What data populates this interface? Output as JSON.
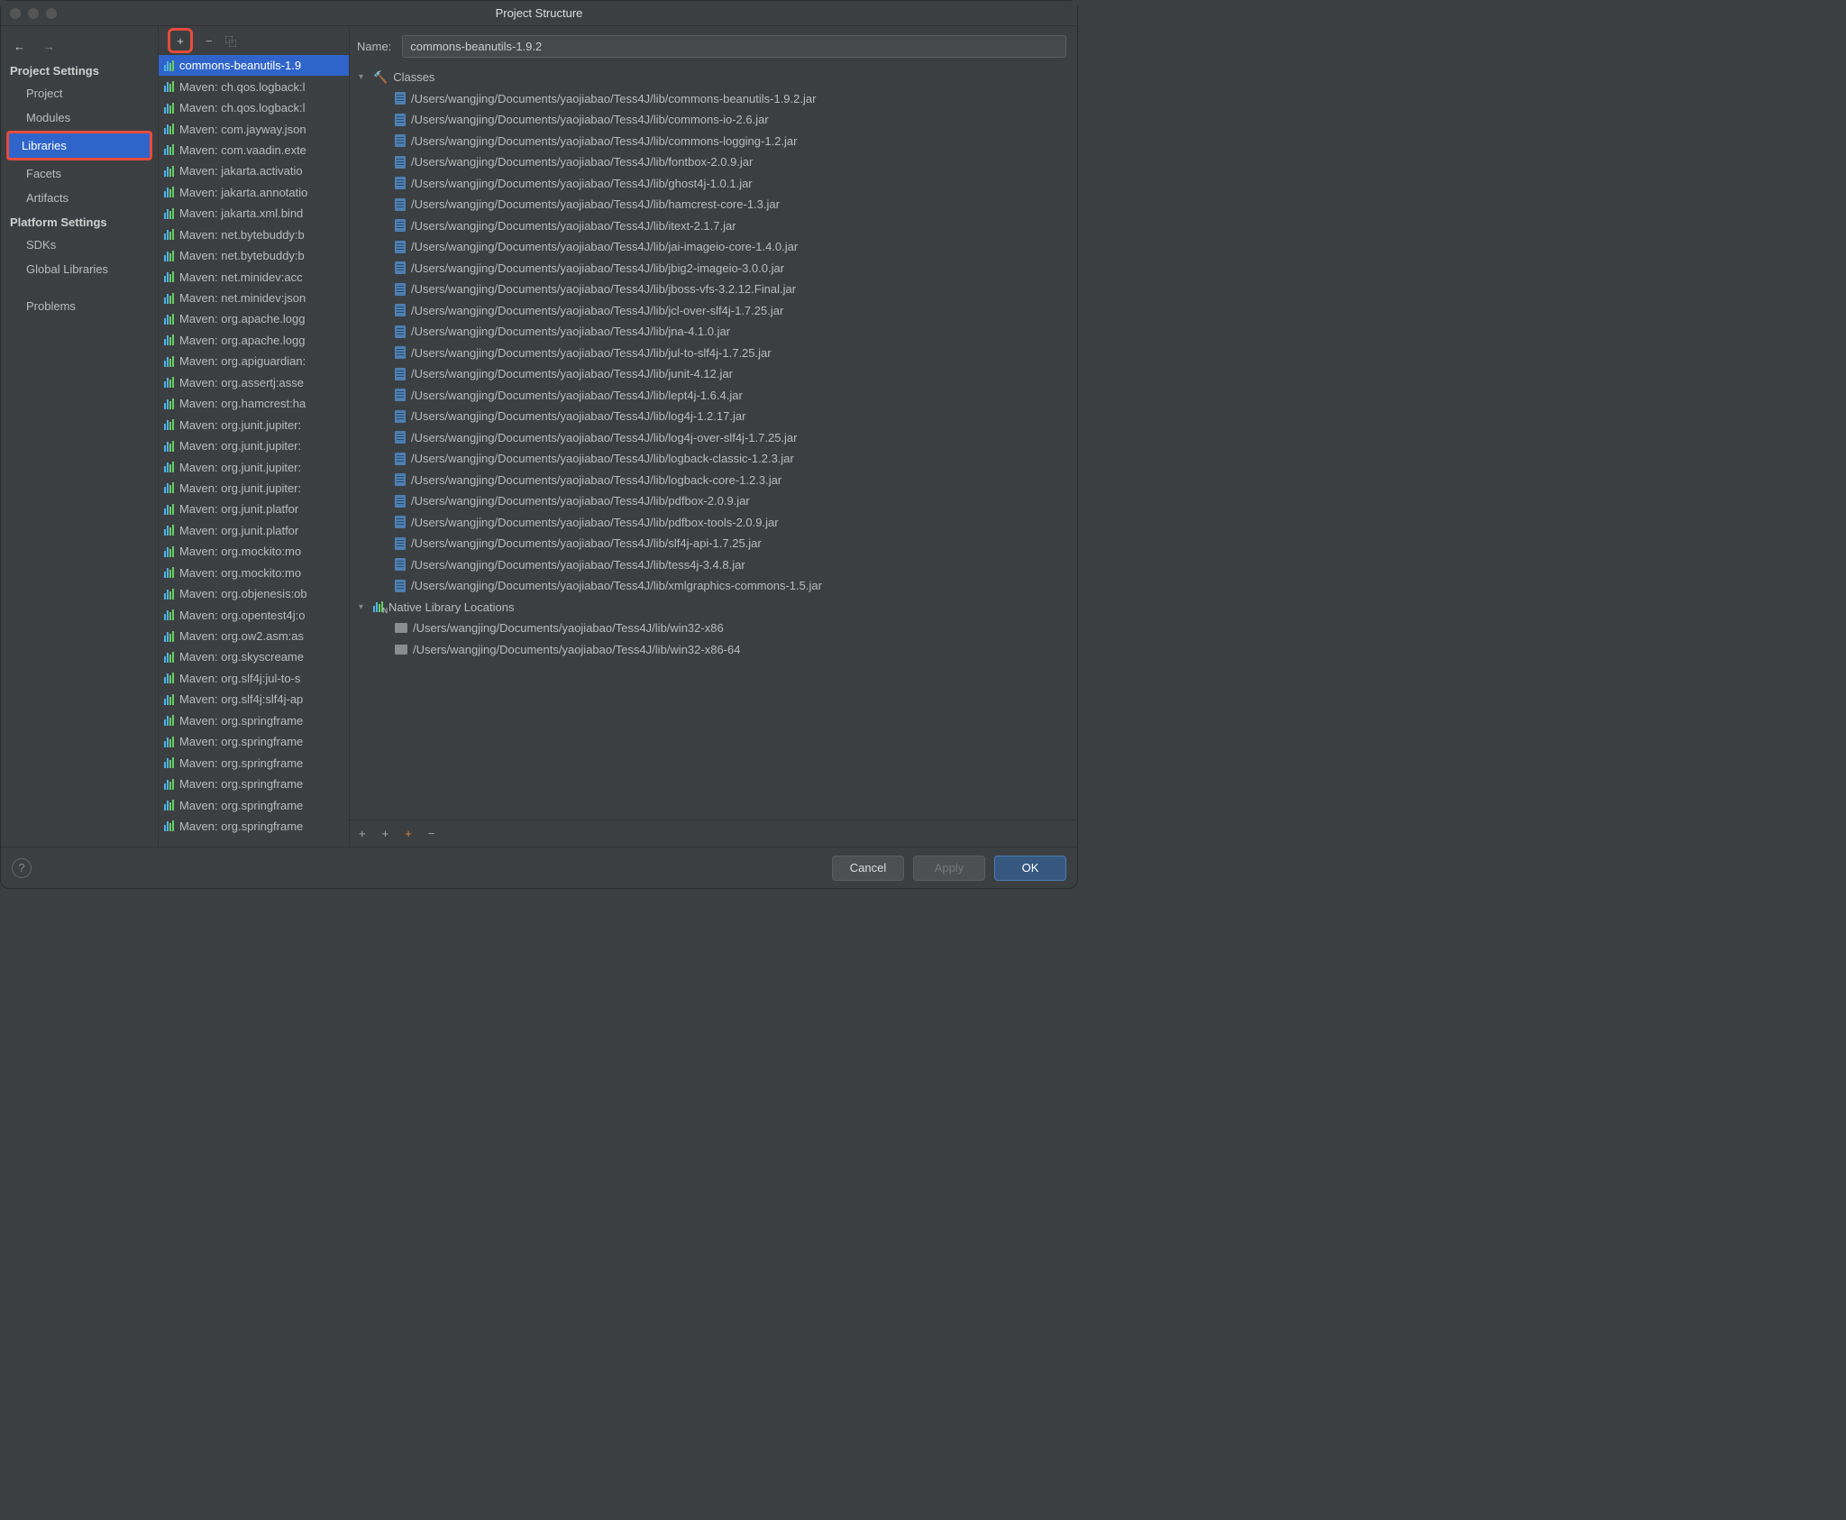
{
  "window": {
    "title": "Project Structure"
  },
  "leftnav": {
    "arrows": {
      "back": "←",
      "fwd": "→"
    },
    "groups": [
      {
        "heading": "Project Settings",
        "items": [
          {
            "key": "project",
            "label": "Project"
          },
          {
            "key": "modules",
            "label": "Modules"
          },
          {
            "key": "libraries",
            "label": "Libraries",
            "selected": true
          },
          {
            "key": "facets",
            "label": "Facets"
          },
          {
            "key": "artifacts",
            "label": "Artifacts"
          }
        ]
      },
      {
        "heading": "Platform Settings",
        "items": [
          {
            "key": "sdks",
            "label": "SDKs"
          },
          {
            "key": "global-libs",
            "label": "Global Libraries"
          }
        ]
      },
      {
        "heading": "",
        "items": [
          {
            "key": "problems",
            "label": "Problems"
          }
        ]
      }
    ]
  },
  "midtoolbar": {
    "add": "+",
    "remove": "−",
    "copy": "⿻"
  },
  "libraries": [
    {
      "label": "commons-beanutils-1.9",
      "selected": true
    },
    {
      "label": "Maven: ch.qos.logback:l"
    },
    {
      "label": "Maven: ch.qos.logback:l"
    },
    {
      "label": "Maven: com.jayway.json"
    },
    {
      "label": "Maven: com.vaadin.exte"
    },
    {
      "label": "Maven: jakarta.activatio"
    },
    {
      "label": "Maven: jakarta.annotatio"
    },
    {
      "label": "Maven: jakarta.xml.bind"
    },
    {
      "label": "Maven: net.bytebuddy:b"
    },
    {
      "label": "Maven: net.bytebuddy:b"
    },
    {
      "label": "Maven: net.minidev:acc"
    },
    {
      "label": "Maven: net.minidev:json"
    },
    {
      "label": "Maven: org.apache.logg"
    },
    {
      "label": "Maven: org.apache.logg"
    },
    {
      "label": "Maven: org.apiguardian:"
    },
    {
      "label": "Maven: org.assertj:asse"
    },
    {
      "label": "Maven: org.hamcrest:ha"
    },
    {
      "label": "Maven: org.junit.jupiter:"
    },
    {
      "label": "Maven: org.junit.jupiter:"
    },
    {
      "label": "Maven: org.junit.jupiter:"
    },
    {
      "label": "Maven: org.junit.jupiter:"
    },
    {
      "label": "Maven: org.junit.platfor"
    },
    {
      "label": "Maven: org.junit.platfor"
    },
    {
      "label": "Maven: org.mockito:mo"
    },
    {
      "label": "Maven: org.mockito:mo"
    },
    {
      "label": "Maven: org.objenesis:ob"
    },
    {
      "label": "Maven: org.opentest4j:o"
    },
    {
      "label": "Maven: org.ow2.asm:as"
    },
    {
      "label": "Maven: org.skyscreame"
    },
    {
      "label": "Maven: org.slf4j:jul-to-s"
    },
    {
      "label": "Maven: org.slf4j:slf4j-ap"
    },
    {
      "label": "Maven: org.springframe"
    },
    {
      "label": "Maven: org.springframe"
    },
    {
      "label": "Maven: org.springframe"
    },
    {
      "label": "Maven: org.springframe"
    },
    {
      "label": "Maven: org.springframe"
    },
    {
      "label": "Maven: org.springframe"
    }
  ],
  "right": {
    "name_label": "Name:",
    "name_value": "commons-beanutils-1.9.2",
    "classes_label": "Classes",
    "native_label": "Native Library Locations",
    "classes": [
      "/Users/wangjing/Documents/yaojiabao/Tess4J/lib/commons-beanutils-1.9.2.jar",
      "/Users/wangjing/Documents/yaojiabao/Tess4J/lib/commons-io-2.6.jar",
      "/Users/wangjing/Documents/yaojiabao/Tess4J/lib/commons-logging-1.2.jar",
      "/Users/wangjing/Documents/yaojiabao/Tess4J/lib/fontbox-2.0.9.jar",
      "/Users/wangjing/Documents/yaojiabao/Tess4J/lib/ghost4j-1.0.1.jar",
      "/Users/wangjing/Documents/yaojiabao/Tess4J/lib/hamcrest-core-1.3.jar",
      "/Users/wangjing/Documents/yaojiabao/Tess4J/lib/itext-2.1.7.jar",
      "/Users/wangjing/Documents/yaojiabao/Tess4J/lib/jai-imageio-core-1.4.0.jar",
      "/Users/wangjing/Documents/yaojiabao/Tess4J/lib/jbig2-imageio-3.0.0.jar",
      "/Users/wangjing/Documents/yaojiabao/Tess4J/lib/jboss-vfs-3.2.12.Final.jar",
      "/Users/wangjing/Documents/yaojiabao/Tess4J/lib/jcl-over-slf4j-1.7.25.jar",
      "/Users/wangjing/Documents/yaojiabao/Tess4J/lib/jna-4.1.0.jar",
      "/Users/wangjing/Documents/yaojiabao/Tess4J/lib/jul-to-slf4j-1.7.25.jar",
      "/Users/wangjing/Documents/yaojiabao/Tess4J/lib/junit-4.12.jar",
      "/Users/wangjing/Documents/yaojiabao/Tess4J/lib/lept4j-1.6.4.jar",
      "/Users/wangjing/Documents/yaojiabao/Tess4J/lib/log4j-1.2.17.jar",
      "/Users/wangjing/Documents/yaojiabao/Tess4J/lib/log4j-over-slf4j-1.7.25.jar",
      "/Users/wangjing/Documents/yaojiabao/Tess4J/lib/logback-classic-1.2.3.jar",
      "/Users/wangjing/Documents/yaojiabao/Tess4J/lib/logback-core-1.2.3.jar",
      "/Users/wangjing/Documents/yaojiabao/Tess4J/lib/pdfbox-2.0.9.jar",
      "/Users/wangjing/Documents/yaojiabao/Tess4J/lib/pdfbox-tools-2.0.9.jar",
      "/Users/wangjing/Documents/yaojiabao/Tess4J/lib/slf4j-api-1.7.25.jar",
      "/Users/wangjing/Documents/yaojiabao/Tess4J/lib/tess4j-3.4.8.jar",
      "/Users/wangjing/Documents/yaojiabao/Tess4J/lib/xmlgraphics-commons-1.5.jar"
    ],
    "native": [
      "/Users/wangjing/Documents/yaojiabao/Tess4J/lib/win32-x86",
      "/Users/wangjing/Documents/yaojiabao/Tess4J/lib/win32-x86-64"
    ],
    "toolbar": {
      "add": "+",
      "add2": "+",
      "add3": "+",
      "remove": "−"
    }
  },
  "footer": {
    "help": "?",
    "cancel": "Cancel",
    "apply": "Apply",
    "ok": "OK"
  }
}
